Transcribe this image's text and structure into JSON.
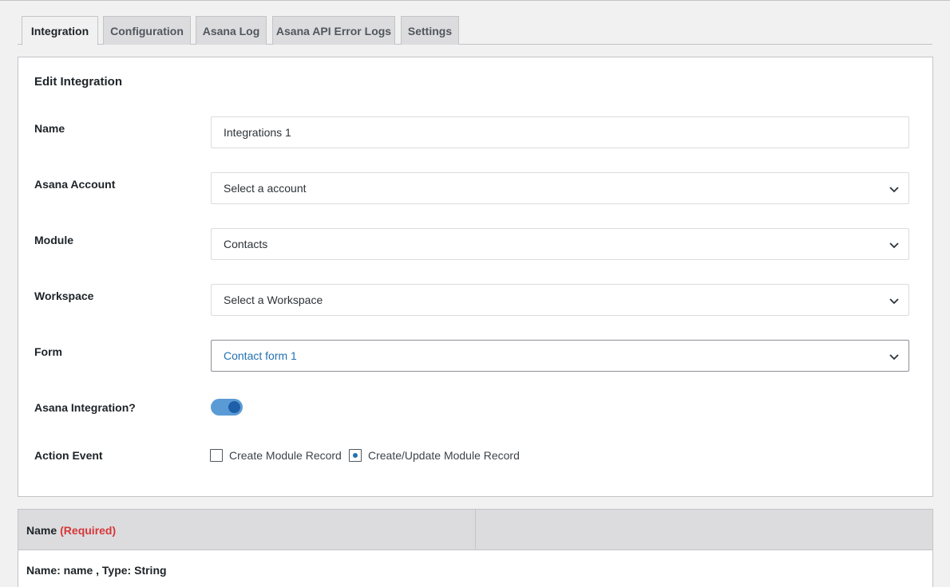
{
  "tabs": [
    {
      "label": "Integration",
      "active": true
    },
    {
      "label": "Configuration",
      "active": false
    },
    {
      "label": "Asana Log",
      "active": false
    },
    {
      "label": "Asana API Error Logs",
      "active": false
    },
    {
      "label": "Settings",
      "active": false
    }
  ],
  "form": {
    "title": "Edit Integration",
    "name": {
      "label": "Name",
      "value": "Integrations 1"
    },
    "account": {
      "label": "Asana Account",
      "selected": "Select a account"
    },
    "module": {
      "label": "Module",
      "selected": "Contacts"
    },
    "workspace": {
      "label": "Workspace",
      "selected": "Select a Workspace"
    },
    "form_select": {
      "label": "Form",
      "selected": "Contact form 1"
    },
    "integration_toggle": {
      "label": "Asana Integration?",
      "on": true
    },
    "action_event": {
      "label": "Action Event",
      "options": [
        {
          "label": "Create Module Record",
          "checked": false
        },
        {
          "label": "Create/Update Module Record",
          "checked": true
        }
      ]
    }
  },
  "mapping": {
    "header_name": "Name",
    "header_required": "(Required)",
    "row_text": "Name: name , Type: String"
  },
  "colors": {
    "accent": "#2271b1",
    "toggle_track": "#5b9bd5",
    "required": "#d63638"
  }
}
